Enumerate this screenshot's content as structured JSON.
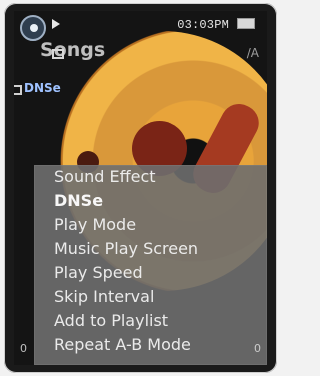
{
  "status": {
    "time": "03:03PM"
  },
  "header": {
    "title": "Songs",
    "subtitle": "DNSe"
  },
  "menu": {
    "items": [
      {
        "label": "Sound Effect",
        "selected": false
      },
      {
        "label": "DNSe",
        "selected": true
      },
      {
        "label": "Play Mode",
        "selected": false
      },
      {
        "label": "Music Play Screen",
        "selected": false
      },
      {
        "label": "Play Speed",
        "selected": false
      },
      {
        "label": "Skip Interval",
        "selected": false
      },
      {
        "label": "Add to Playlist",
        "selected": false
      },
      {
        "label": "Repeat A-B Mode",
        "selected": false
      }
    ]
  },
  "footer": {
    "left": "0",
    "right": "0"
  },
  "icons": {
    "logo": "player-logo-icon",
    "play": "play-icon",
    "battery": "battery-icon",
    "folder": "folder-icon",
    "songs": "songs-icon"
  }
}
